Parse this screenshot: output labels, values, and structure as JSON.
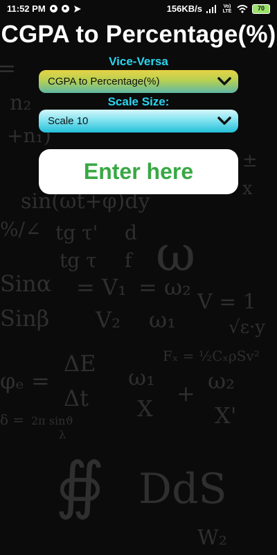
{
  "status_bar": {
    "time": "11:52 PM",
    "network_speed": "156KB/s",
    "battery": "70",
    "icons": [
      "paypal-icon",
      "paypal-icon",
      "send-icon",
      "signal-icon",
      "wifi-icon",
      "volte-icon",
      "battery-icon"
    ],
    "volte_label": "Vo) LTE"
  },
  "header": {
    "title": "CGPA to Percentage(%)"
  },
  "vice_versa": {
    "label": "Vice-Versa",
    "selected": "CGPA to Percentage(%)"
  },
  "scale": {
    "label": "Scale Size:",
    "selected": "Scale 10"
  },
  "input": {
    "placeholder": "Enter here"
  },
  "colors": {
    "accent_label": "#2ad6f0",
    "enter_text": "#39a844",
    "background": "#0b0b0b"
  }
}
